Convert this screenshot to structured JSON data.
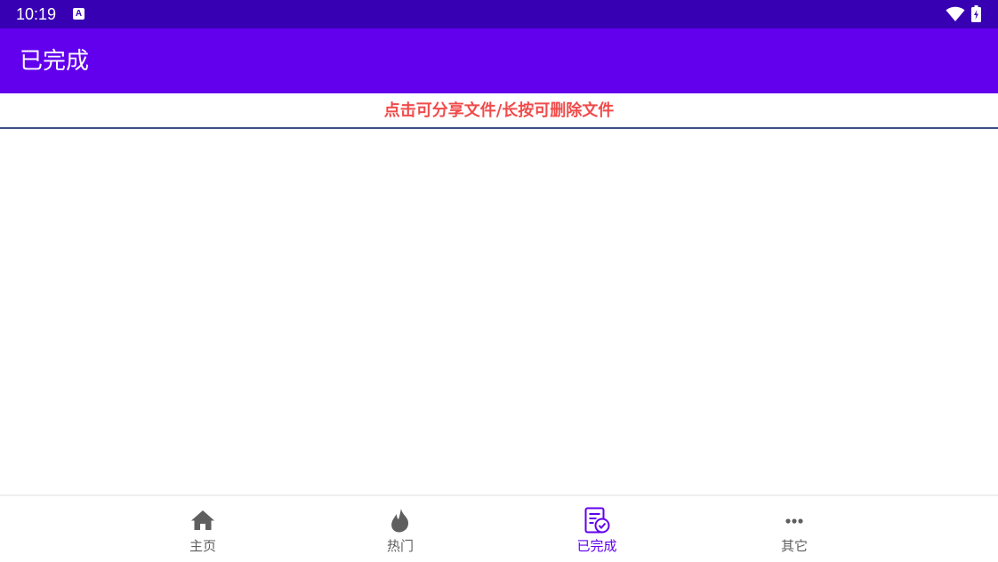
{
  "status_bar": {
    "time": "10:19",
    "notification_glyph": "A",
    "icons": [
      "notification-a-icon",
      "wifi-icon",
      "battery-icon"
    ]
  },
  "app_bar": {
    "title": "已完成"
  },
  "hint": {
    "text": "点击可分享文件/长按可删除文件",
    "color": "#f04b4b"
  },
  "bottom_nav": {
    "items": [
      {
        "label": "主页",
        "icon": "home-icon",
        "active": false
      },
      {
        "label": "热门",
        "icon": "fire-icon",
        "active": false
      },
      {
        "label": "已完成",
        "icon": "checklist-icon",
        "active": true
      },
      {
        "label": "其它",
        "icon": "more-icon",
        "active": false
      }
    ],
    "active_color": "#6200ee",
    "inactive_color": "#5f5f5f"
  },
  "colors": {
    "status_bar": "#3700b3",
    "app_bar": "#6200ee",
    "divider": "#3d4f86"
  }
}
